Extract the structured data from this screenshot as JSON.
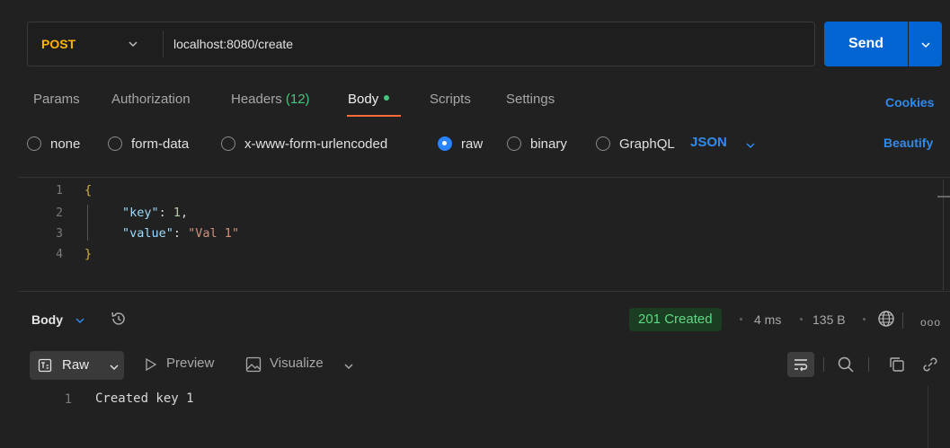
{
  "request": {
    "method": "POST",
    "url": "localhost:8080/create",
    "send_label": "Send"
  },
  "tabs": [
    {
      "label": "Params"
    },
    {
      "label": "Authorization"
    },
    {
      "label": "Headers",
      "count": "(12)"
    },
    {
      "label": "Body",
      "active": true
    },
    {
      "label": "Scripts"
    },
    {
      "label": "Settings"
    }
  ],
  "cookies_label": "Cookies",
  "body_types": [
    {
      "label": "none",
      "selected": false
    },
    {
      "label": "form-data",
      "selected": false
    },
    {
      "label": "x-www-form-urlencoded",
      "selected": false
    },
    {
      "label": "raw",
      "selected": true
    },
    {
      "label": "binary",
      "selected": false
    },
    {
      "label": "GraphQL",
      "selected": false
    }
  ],
  "language": "JSON",
  "beautify_label": "Beautify",
  "editor": {
    "line_numbers": [
      "1",
      "2",
      "3",
      "4"
    ],
    "open_brace": "{",
    "close_brace": "}",
    "line2_key": "\"key\"",
    "line2_colon": ": ",
    "line2_value": "1",
    "line2_comma": ",",
    "line3_key": "\"value\"",
    "line3_colon": ": ",
    "line3_value": "\"Val 1\""
  },
  "response": {
    "section_label": "Body",
    "status": "201 Created",
    "time": "4 ms",
    "size": "135 B",
    "more": "ooo",
    "view_mode": "Raw",
    "preview_label": "Preview",
    "visualize_label": "Visualize",
    "line_number": "1",
    "content": "Created key 1"
  },
  "colors": {
    "accent_blue": "#0265d2",
    "method_post": "#ffb400",
    "status_success": "#5ed985",
    "active_tab_underline": "#ff6c37"
  }
}
